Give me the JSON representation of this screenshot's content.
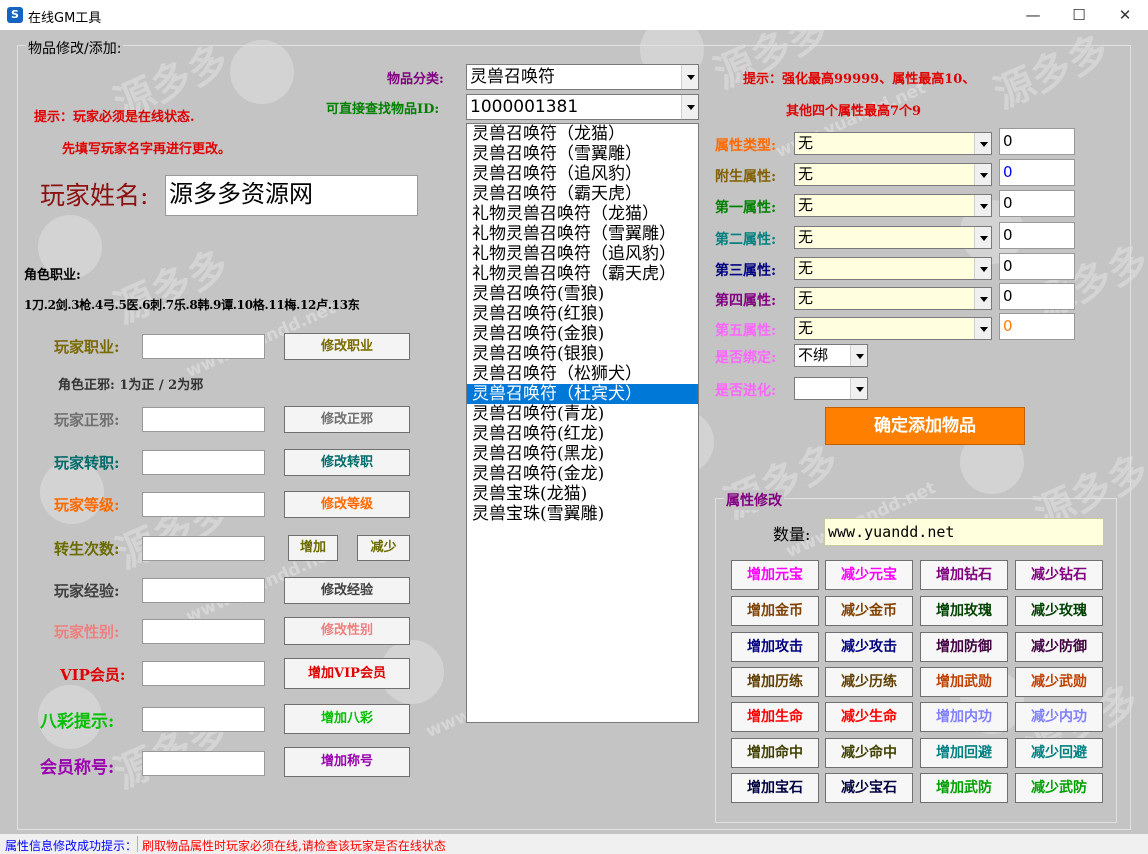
{
  "window": {
    "title": "在线GM工具",
    "icon": "app-icon",
    "minimize": "—",
    "maximize": "☐",
    "close": "✕"
  },
  "watermark": {
    "text": "源多多",
    "url": "www.yuandd.net"
  },
  "group": {
    "title": "物品修改/添加:"
  },
  "left": {
    "hint1": "提示：玩家必须是在线状态.",
    "hint2": "先填写玩家名字再进行更改。",
    "name_label": "玩家姓名:",
    "name_value": "源多多资源网",
    "role_label": "角色职业:",
    "role_list": "1刀.2剑.3枪.4弓.5医.6刺.7乐.8韩.9谭.10格.11梅.12卢.13东",
    "align_hint": "角色正邪: 1为正 / 2为邪",
    "rows": [
      {
        "label": "玩家职业:",
        "button": "修改职业",
        "color": "#7a6a00"
      },
      {
        "label": "玩家正邪:",
        "button": "修改正邪",
        "color": "#707070"
      },
      {
        "label": "玩家转职:",
        "button": "修改转职",
        "color": "#006b6b"
      },
      {
        "label": "玩家等级:",
        "button": "修改等级",
        "color": "#ff6a00"
      },
      {
        "label": "转生次数:",
        "button_a": "增加",
        "button_b": "减少",
        "color": "#6b6b00"
      },
      {
        "label": "玩家经验:",
        "button": "修改经验",
        "color": "#404040"
      },
      {
        "label": "玩家性别:",
        "button": "修改性别",
        "color": "#f08080"
      },
      {
        "label": "VIP会员:",
        "button": "增加VIP会员",
        "color": "#e00000"
      },
      {
        "label": "八彩提示:",
        "button": "增加八彩",
        "color": "#00c000"
      },
      {
        "label": "会员称号:",
        "button": "增加称号",
        "color": "#9b00b0"
      }
    ]
  },
  "middle": {
    "category_label": "物品分类:",
    "category_value": "灵兽召唤符",
    "search_label": "可直接查找物品ID:",
    "search_value": "1000001381",
    "items": [
      "灵兽召唤符（龙猫）",
      "灵兽召唤符（雪翼雕）",
      "灵兽召唤符（追风豹）",
      "灵兽召唤符（霸天虎）",
      "礼物灵兽召唤符（龙猫）",
      "礼物灵兽召唤符（雪翼雕）",
      "礼物灵兽召唤符（追风豹）",
      "礼物灵兽召唤符（霸天虎）",
      "灵兽召唤符(雪狼)",
      "灵兽召唤符(红狼)",
      "灵兽召唤符(金狼)",
      "灵兽召唤符(银狼)",
      "灵兽召唤符（松狮犬）",
      "灵兽召唤符（杜宾犬）",
      "灵兽召唤符(青龙)",
      "灵兽召唤符(红龙)",
      "灵兽召唤符(黑龙)",
      "灵兽召唤符(金龙)",
      "灵兽宝珠(龙猫)",
      "灵兽宝珠(雪翼雕)"
    ],
    "selected_index": 13
  },
  "right": {
    "tip1": "提示：强化最高99999、属性最高10、",
    "tip2": "其他四个属性最高7个9",
    "attrs": [
      {
        "label": "属性类型:",
        "combo": "无",
        "value": "0",
        "color": "#ff6a00",
        "value_color": "#000000"
      },
      {
        "label": "附生属性:",
        "combo": "无",
        "value": "0",
        "color": "#806000",
        "value_color": "#0000ff"
      },
      {
        "label": "第一属性:",
        "combo": "无",
        "value": "0",
        "color": "#008000",
        "value_color": "#000000"
      },
      {
        "label": "第二属性:",
        "combo": "无",
        "value": "0",
        "color": "#008080",
        "value_color": "#000000"
      },
      {
        "label": "第三属性:",
        "combo": "无",
        "value": "0",
        "color": "#000080",
        "value_color": "#000000"
      },
      {
        "label": "第四属性:",
        "combo": "无",
        "value": "0",
        "color": "#800080",
        "value_color": "#000000"
      },
      {
        "label": "第五属性:",
        "combo": "无",
        "value": "0",
        "color": "#ff66ff",
        "value_color": "#ff8000"
      }
    ],
    "bind_label": "是否绑定:",
    "bind_value": "不绑",
    "evolve_label": "是否进化:",
    "evolve_value": "",
    "confirm_button": "确定添加物品",
    "prop": {
      "title": "属性修改",
      "qty_label": "数量:",
      "qty_value": "www.yuandd.net",
      "buttons": [
        [
          {
            "text": "增加元宝",
            "color": "#ff00ff"
          },
          {
            "text": "减少元宝",
            "color": "#ff00ff"
          },
          {
            "text": "增加钻石",
            "color": "#800080"
          },
          {
            "text": "减少钻石",
            "color": "#800080"
          }
        ],
        [
          {
            "text": "增加金币",
            "color": "#804000"
          },
          {
            "text": "减少金币",
            "color": "#804000"
          },
          {
            "text": "增加玫瑰",
            "color": "#004000"
          },
          {
            "text": "减少玫瑰",
            "color": "#004000"
          }
        ],
        [
          {
            "text": "增加攻击",
            "color": "#000080"
          },
          {
            "text": "减少攻击",
            "color": "#000080"
          },
          {
            "text": "增加防御",
            "color": "#400040"
          },
          {
            "text": "减少防御",
            "color": "#400040"
          }
        ],
        [
          {
            "text": "增加历练",
            "color": "#604000"
          },
          {
            "text": "减少历练",
            "color": "#604000"
          },
          {
            "text": "增加武勋",
            "color": "#c04000"
          },
          {
            "text": "减少武勋",
            "color": "#c04000"
          }
        ],
        [
          {
            "text": "增加生命",
            "color": "#ff0000"
          },
          {
            "text": "减少生命",
            "color": "#ff0000"
          },
          {
            "text": "增加内功",
            "color": "#8080ff"
          },
          {
            "text": "减少内功",
            "color": "#8080ff"
          }
        ],
        [
          {
            "text": "增加命中",
            "color": "#404000"
          },
          {
            "text": "减少命中",
            "color": "#404000"
          },
          {
            "text": "增加回避",
            "color": "#008080"
          },
          {
            "text": "减少回避",
            "color": "#008080"
          }
        ],
        [
          {
            "text": "增加宝石",
            "color": "#000040"
          },
          {
            "text": "减少宝石",
            "color": "#000040"
          },
          {
            "text": "增加武防",
            "color": "#00a000"
          },
          {
            "text": "减少武防",
            "color": "#00a000"
          }
        ]
      ]
    }
  },
  "status": {
    "left": "属性信息修改成功提示：",
    "right": "刷取物品属性时玩家必须在线,请检查该玩家是否在线状态"
  }
}
